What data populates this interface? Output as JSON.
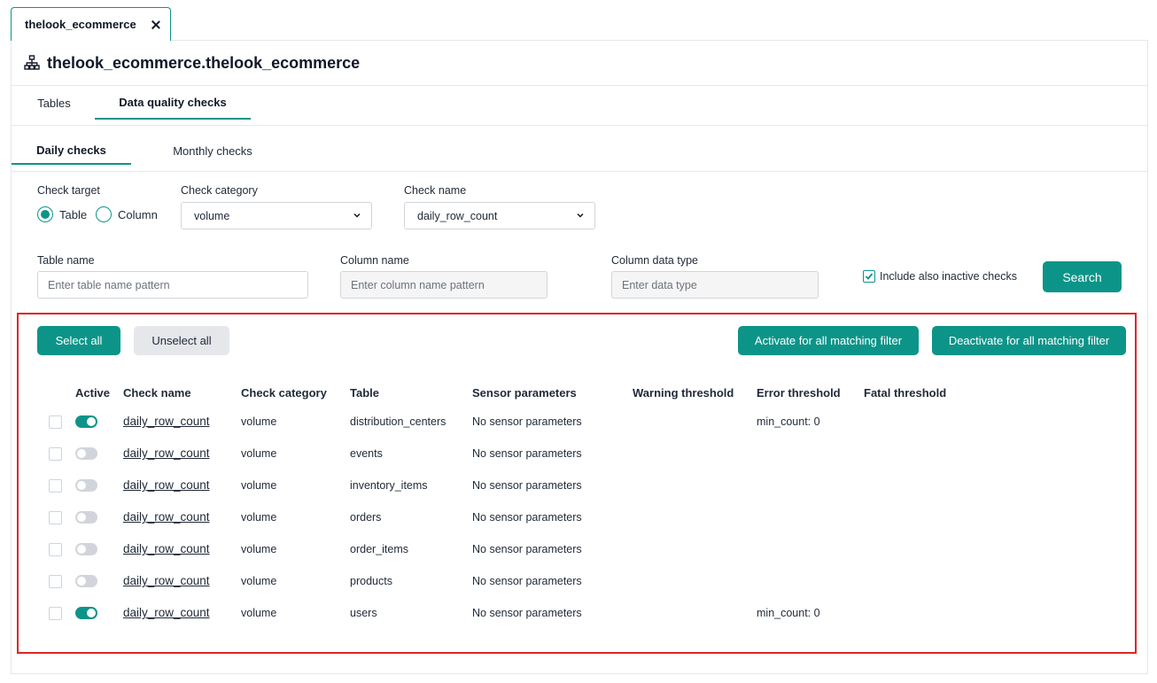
{
  "document_tab": {
    "label": "thelook_ecommerce"
  },
  "header": {
    "title": "thelook_ecommerce.thelook_ecommerce"
  },
  "main_tabs": [
    "Tables",
    "Data quality checks"
  ],
  "sub_tabs": [
    "Daily checks",
    "Monthly checks"
  ],
  "filters": {
    "check_target": {
      "label": "Check target",
      "options": [
        "Table",
        "Column"
      ],
      "selected": "Table"
    },
    "check_category": {
      "label": "Check category",
      "value": "volume"
    },
    "check_name": {
      "label": "Check name",
      "value": "daily_row_count"
    },
    "table_name": {
      "label": "Table name",
      "placeholder": "Enter table name pattern"
    },
    "column_name": {
      "label": "Column name",
      "placeholder": "Enter column name pattern"
    },
    "column_data_type": {
      "label": "Column data type",
      "placeholder": "Enter data type"
    },
    "include_inactive": {
      "label": "Include also inactive checks",
      "checked": true
    },
    "search_label": "Search"
  },
  "actions": {
    "select_all": "Select all",
    "unselect_all": "Unselect all",
    "activate_all": "Activate for all matching filter",
    "deactivate_all": "Deactivate for all matching filter"
  },
  "table": {
    "columns": [
      "Active",
      "Check name",
      "Check category",
      "Table",
      "Sensor parameters",
      "Warning threshold",
      "Error threshold",
      "Fatal threshold"
    ],
    "rows": [
      {
        "active": true,
        "check_name": "daily_row_count",
        "category": "volume",
        "table": "distribution_centers",
        "sensor": "No sensor parameters",
        "warning": "",
        "error": "min_count: 0",
        "fatal": ""
      },
      {
        "active": false,
        "check_name": "daily_row_count",
        "category": "volume",
        "table": "events",
        "sensor": "No sensor parameters",
        "warning": "",
        "error": "",
        "fatal": ""
      },
      {
        "active": false,
        "check_name": "daily_row_count",
        "category": "volume",
        "table": "inventory_items",
        "sensor": "No sensor parameters",
        "warning": "",
        "error": "",
        "fatal": ""
      },
      {
        "active": false,
        "check_name": "daily_row_count",
        "category": "volume",
        "table": "orders",
        "sensor": "No sensor parameters",
        "warning": "",
        "error": "",
        "fatal": ""
      },
      {
        "active": false,
        "check_name": "daily_row_count",
        "category": "volume",
        "table": "order_items",
        "sensor": "No sensor parameters",
        "warning": "",
        "error": "",
        "fatal": ""
      },
      {
        "active": false,
        "check_name": "daily_row_count",
        "category": "volume",
        "table": "products",
        "sensor": "No sensor parameters",
        "warning": "",
        "error": "",
        "fatal": ""
      },
      {
        "active": true,
        "check_name": "daily_row_count",
        "category": "volume",
        "table": "users",
        "sensor": "No sensor parameters",
        "warning": "",
        "error": "min_count: 0",
        "fatal": ""
      }
    ]
  },
  "colors": {
    "accent": "#0d9488",
    "highlight": "#dc2626"
  }
}
